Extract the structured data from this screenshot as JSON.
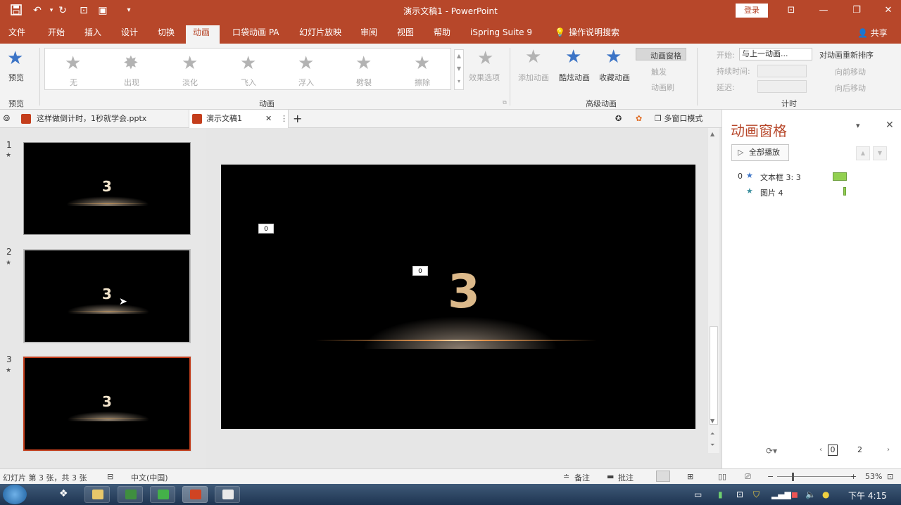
{
  "titlebar": {
    "title": "演示文稿1 - PowerPoint",
    "login": "登录",
    "quick_access": [
      "save-icon",
      "undo-icon",
      "redo-icon",
      "present-icon",
      "layout-icon",
      "customize-icon"
    ]
  },
  "menu": {
    "tabs": [
      "文件",
      "开始",
      "插入",
      "设计",
      "切换",
      "动画",
      "口袋动画 PA",
      "幻灯片放映",
      "审阅",
      "视图",
      "帮助",
      "iSpring Suite 9"
    ],
    "tell_me": "操作说明搜索",
    "share": "共享",
    "active_tab": "动画"
  },
  "ribbon": {
    "preview_group": {
      "button": "预览",
      "label": "预览"
    },
    "animation_group": {
      "effects": [
        "无",
        "出现",
        "淡化",
        "飞入",
        "浮入",
        "劈裂",
        "擦除"
      ],
      "effect_options": "效果选项",
      "label": "动画"
    },
    "advanced_group": {
      "add_animation": "添加动画",
      "cool_animation": "酷炫动画",
      "fav_animation": "收藏动画",
      "animation_pane": "动画窗格",
      "trigger": "触发",
      "animation_painter": "动画刷",
      "label": "高级动画"
    },
    "timing_group": {
      "start_label": "开始:",
      "start_value": "与上一动画...",
      "duration_label": "持续时间:",
      "delay_label": "延迟:",
      "reorder_title": "对动画重新排序",
      "move_earlier": "向前移动",
      "move_later": "向后移动",
      "label": "计时"
    }
  },
  "doc_tabs": {
    "tab1": "这样做倒计时，1秒就学会.pptx",
    "tab2": "演示文稿1",
    "multi_window": "多窗口模式"
  },
  "slides": [
    {
      "number": "1",
      "text": "3"
    },
    {
      "number": "2",
      "text": "3"
    },
    {
      "number": "3",
      "text": "3"
    }
  ],
  "main_slide": {
    "text": "3",
    "tag_a": "0",
    "tag_b": "0"
  },
  "animation_pane": {
    "title": "动画窗格",
    "play_all": "全部播放",
    "items": [
      {
        "index": "0",
        "name": "文本框 3: 3",
        "color": "#92d050"
      },
      {
        "index": "",
        "name": "图片 4",
        "color": "#92d050"
      }
    ],
    "timeline_start": "0",
    "timeline_end": "2"
  },
  "statusbar": {
    "slide_info": "幻灯片 第 3 张，共 3 张",
    "language": "中文(中国)",
    "notes": "备注",
    "comments": "批注",
    "zoom": "53%"
  },
  "taskbar": {
    "clock": "下午 4:15"
  },
  "colors": {
    "accent": "#b7472a",
    "selected_slide_border": "#c43e1c",
    "number_gold": "#dcb98a"
  }
}
